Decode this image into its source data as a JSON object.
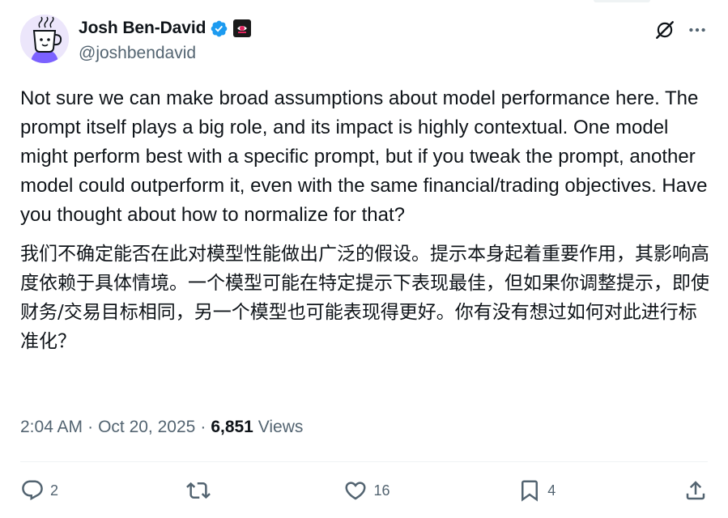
{
  "author": {
    "display_name": "Josh Ben-David",
    "handle": "@joshbendavid",
    "verified": true,
    "avatar_icon": "coffee-cup-avatar",
    "affiliation_icon": "affiliate-badge-icon"
  },
  "post": {
    "text_en": "Not sure we can make broad assumptions about model performance here. The prompt itself plays a big role, and its impact is highly contextual. One model might perform best with a specific prompt, but if you tweak the prompt, another model could outperform it, even with the same financial/trading objectives. Have you thought about how to normalize for that?",
    "text_zh": "我们不确定能否在此对模型性能做出广泛的假设。提示本身起着重要作用，其影响高度依赖于具体情境。一个模型可能在特定提示下表现最佳，但如果你调整提示，即使财务/交易目标相同，另一个模型也可能表现得更好。你有没有想过如何对此进行标准化？"
  },
  "meta": {
    "time": "2:04 AM",
    "separator": "·",
    "date": "Oct 20, 2025",
    "views_count": "6,851",
    "views_label": "Views"
  },
  "engagement": {
    "replies": "2",
    "reposts": "",
    "likes": "16",
    "bookmarks": "4"
  },
  "colors": {
    "text": "#0f1419",
    "secondary": "#536471",
    "verified": "#1d9bf0",
    "divider": "#eff3f4"
  }
}
